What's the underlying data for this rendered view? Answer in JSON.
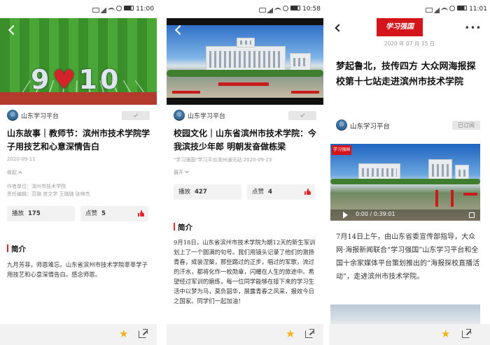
{
  "status_bars": [
    {
      "time": "11:00"
    },
    {
      "time": "10:58"
    },
    {
      "time": "11:01"
    }
  ],
  "articles": [
    {
      "hero_caption": "",
      "formation_text": [
        "9",
        "10"
      ],
      "publisher": "山东学习平台",
      "title": "山东故事｜教师节：滨州市技术学院学子用技艺和心意深情告白",
      "date": "2020-09-11",
      "toggle_label": "收起",
      "author_unit": "作者单位：滨州市技术学院",
      "editor": "责任编辑：范璐 宫文学 王璐璐 张坤杰",
      "plays_label": "播放",
      "plays": "175",
      "likes_label": "点赞",
      "likes": "5",
      "section_label": "简介",
      "intro": "九月芳菲，师恩难忘。山东省滨州市技术学院莘莘学子用技艺和心意深情告白。感念师恩。"
    },
    {
      "publisher": "山东学习平台",
      "title": "校园文化｜山东省滨州市技术学院：今我滨技少年郎 明朝发奋做栋梁",
      "source_date": "\"学习强国\"学习平台滨州通讯站  2020-09-23",
      "toggle_label": "展开",
      "plays_label": "播放",
      "plays": "427",
      "likes_label": "点赞",
      "likes": "4",
      "section_label": "简介",
      "intro": "9月18日，山东省滨州市技术学院为期12天的新生军训划上了一个圆满的句号。我们用镜头记录了他们的激扬青春，成装涅槃，那些踢过的正步，唱过的军歌，流过的汗水，都将化作一枚勋章，闪耀在人生的旅途中。希望经过军训的磨练，每一位同学能够在接下来的学习生活中以梦为马，莫负韶华，展露青春之风采，报效今日之国家。同学们一起加油！"
    },
    {
      "logo_text": "学习强国",
      "date": "2020 年 07 月 15 日",
      "title": "梦起鲁北，技传四方 大众网海报探校第十七站走进滨州市技术学院",
      "publisher": "山东学习平台",
      "subscribe_label": "已订阅",
      "video_logo": "学习强国",
      "video_time": "0:00 / 0:39:01",
      "body": "7月14日上午，由山东省委宣传部指导，大众网·海报新闻联合“学习强国”山东学习平台和全国十余家媒体平台策划推出的“海报探校直播活动”，走进滨州市技术学院。"
    }
  ],
  "colors": {
    "accent_red": "#e3262c",
    "star": "#f3b21a",
    "logo_red": "#d4151b"
  },
  "icons": [
    "back-icon",
    "check-icon",
    "thumb-up-icon",
    "star-icon",
    "share-icon",
    "more-icon",
    "play-icon",
    "fullscreen-icon"
  ]
}
